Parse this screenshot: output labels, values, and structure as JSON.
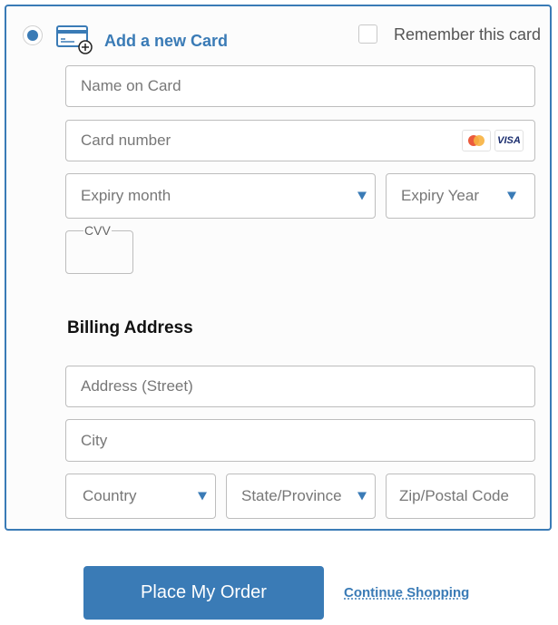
{
  "payment": {
    "option_label": "Add a new Card",
    "option_selected": true,
    "remember_label": "Remember this card",
    "remember_checked": false,
    "name_placeholder": "Name on Card",
    "number_placeholder": "Card number",
    "card_brands": [
      "mastercard-icon",
      "visa-icon"
    ],
    "visa_text": "VISA",
    "expiry_month_label": "Expiry month",
    "expiry_year_label": "Expiry Year",
    "cvv_label": "CVV"
  },
  "billing": {
    "heading": "Billing Address",
    "street_placeholder": "Address (Street)",
    "city_placeholder": "City",
    "country_label": "Country",
    "state_label": "State/Province",
    "zip_placeholder": "Zip/Postal Code"
  },
  "actions": {
    "place_order_label": "Place My Order",
    "continue_label": "Continue Shopping"
  },
  "colors": {
    "accent": "#3a7bb6"
  }
}
